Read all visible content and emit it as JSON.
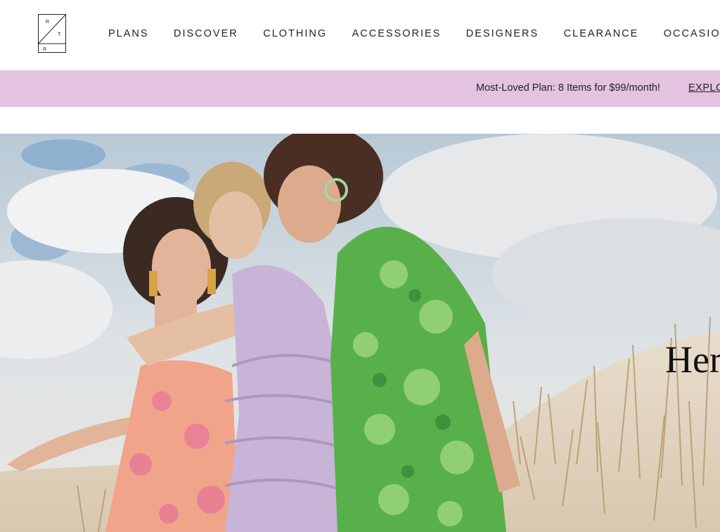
{
  "logo": {
    "letters": [
      "R",
      "T",
      "R"
    ],
    "name": "rtr-logo"
  },
  "nav": {
    "items": [
      {
        "label": "PLANS"
      },
      {
        "label": "DISCOVER"
      },
      {
        "label": "CLOTHING"
      },
      {
        "label": "ACCESSORIES"
      },
      {
        "label": "DESIGNERS"
      },
      {
        "label": "CLEARANCE"
      },
      {
        "label": "OCCASIO"
      }
    ]
  },
  "promo": {
    "text": "Most-Loved Plan: 8 Items for $99/month!",
    "link": "EXPLO",
    "background": "#e3c3df"
  },
  "hero": {
    "title": "Her",
    "image": "three-women-beach-dunes"
  }
}
